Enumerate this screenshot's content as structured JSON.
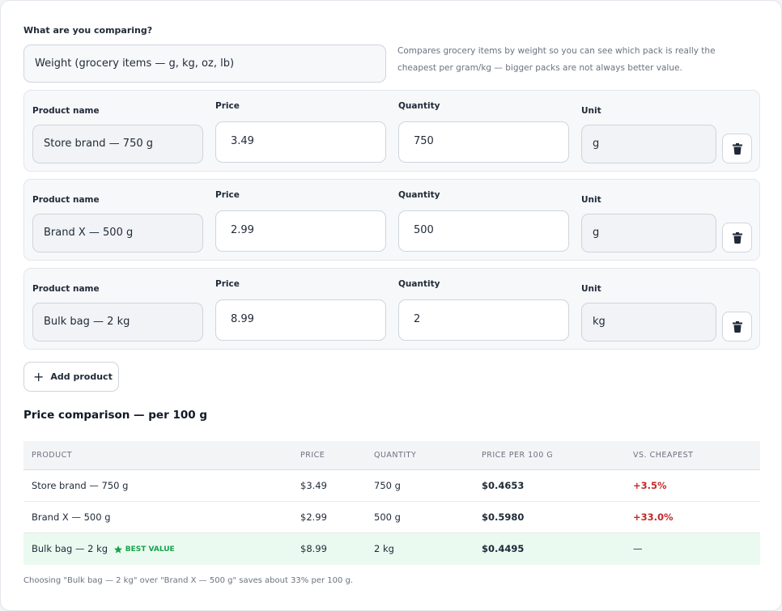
{
  "comparison": {
    "label": "What are you comparing?",
    "selected": "Weight (grocery items — g, kg, oz, lb)",
    "helper": "Compares grocery items by weight so you can see which pack is really the cheapest per gram/kg — bigger packs are not always better value."
  },
  "labels": {
    "product_name": "Product name",
    "price": "Price",
    "quantity": "Quantity",
    "unit": "Unit"
  },
  "products": [
    {
      "name": "Store brand — 750 g",
      "price": "3.49",
      "quantity": "750",
      "unit": "g"
    },
    {
      "name": "Brand X — 500 g",
      "price": "2.99",
      "quantity": "500",
      "unit": "g"
    },
    {
      "name": "Bulk bag — 2 kg",
      "price": "8.99",
      "quantity": "2",
      "unit": "kg"
    }
  ],
  "add_button": {
    "icon": "+",
    "label": "Add product"
  },
  "results": {
    "title": "Price comparison — per 100 g",
    "columns": [
      "PRODUCT",
      "PRICE",
      "QUANTITY",
      "PRICE PER 100 G",
      "VS. CHEAPEST"
    ],
    "rows": [
      {
        "product": "Store brand — 750 g",
        "price": "$3.49",
        "quantity": "750 g",
        "per_unit": "$0.4653",
        "vs": "+3.5%"
      },
      {
        "product": "Brand X — 500 g",
        "price": "$2.99",
        "quantity": "500 g",
        "per_unit": "$0.5980",
        "vs": "+33.0%"
      },
      {
        "product": "Bulk bag — 2 kg",
        "badge": "BEST VALUE",
        "price": "$8.99",
        "quantity": "2 kg",
        "per_unit": "$0.4495",
        "vs": "—"
      }
    ],
    "footnote": "Choosing \"Bulk bag — 2 kg\" over \"Brand X — 500 g\" saves about 33% per 100 g."
  },
  "colors": {
    "best_value": "#16a34a",
    "best_row_bg": "#ebfaf1",
    "price_increase": "#c62828"
  },
  "icons": {
    "delete": "trash-icon",
    "add": "plus-icon",
    "best": "star-icon"
  }
}
